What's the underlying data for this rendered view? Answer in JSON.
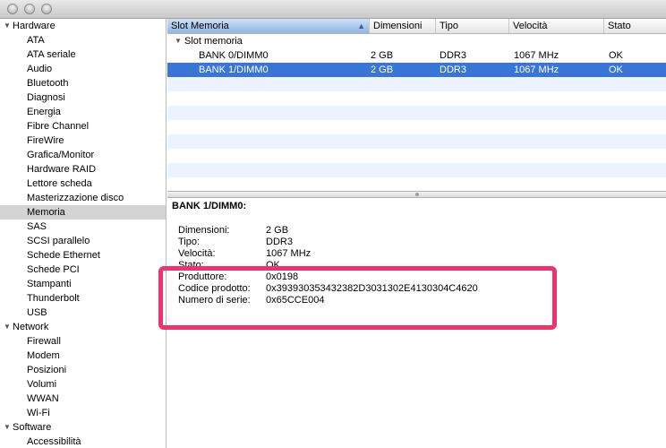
{
  "window": {
    "title": ""
  },
  "sidebar": {
    "rows": [
      {
        "kind": "cat",
        "label": "Hardware"
      },
      {
        "kind": "item",
        "label": "ATA"
      },
      {
        "kind": "item",
        "label": "ATA seriale"
      },
      {
        "kind": "item",
        "label": "Audio"
      },
      {
        "kind": "item",
        "label": "Bluetooth"
      },
      {
        "kind": "item",
        "label": "Diagnosi"
      },
      {
        "kind": "item",
        "label": "Energia"
      },
      {
        "kind": "item",
        "label": "Fibre Channel"
      },
      {
        "kind": "item",
        "label": "FireWire"
      },
      {
        "kind": "item",
        "label": "Grafica/Monitor"
      },
      {
        "kind": "item",
        "label": "Hardware RAID"
      },
      {
        "kind": "item",
        "label": "Lettore scheda"
      },
      {
        "kind": "item",
        "label": "Masterizzazione disco"
      },
      {
        "kind": "item",
        "label": "Memoria",
        "selected": true
      },
      {
        "kind": "item",
        "label": "SAS"
      },
      {
        "kind": "item",
        "label": "SCSI parallelo"
      },
      {
        "kind": "item",
        "label": "Schede Ethernet"
      },
      {
        "kind": "item",
        "label": "Schede PCI"
      },
      {
        "kind": "item",
        "label": "Stampanti"
      },
      {
        "kind": "item",
        "label": "Thunderbolt"
      },
      {
        "kind": "item",
        "label": "USB"
      },
      {
        "kind": "cat",
        "label": "Network"
      },
      {
        "kind": "item",
        "label": "Firewall"
      },
      {
        "kind": "item",
        "label": "Modem"
      },
      {
        "kind": "item",
        "label": "Posizioni"
      },
      {
        "kind": "item",
        "label": "Volumi"
      },
      {
        "kind": "item",
        "label": "WWAN"
      },
      {
        "kind": "item",
        "label": "Wi-Fi"
      },
      {
        "kind": "cat",
        "label": "Software"
      },
      {
        "kind": "item",
        "label": "Accessibilità"
      }
    ]
  },
  "table": {
    "columns": [
      "Slot Memoria",
      "Dimensioni",
      "Tipo",
      "Velocità",
      "Stato"
    ],
    "group": "Slot memoria",
    "rows": [
      {
        "cells": [
          "BANK 0/DIMM0",
          "2 GB",
          "DDR3",
          "1067 MHz",
          "OK"
        ],
        "selected": false
      },
      {
        "cells": [
          "BANK 1/DIMM0",
          "2 GB",
          "DDR3",
          "1067 MHz",
          "OK"
        ],
        "selected": true
      }
    ]
  },
  "details": {
    "title": "BANK 1/DIMM0:",
    "fields": [
      {
        "label": "Dimensioni:",
        "value": "2 GB"
      },
      {
        "label": "Tipo:",
        "value": "DDR3"
      },
      {
        "label": "Velocità:",
        "value": "1067 MHz"
      },
      {
        "label": "Stato:",
        "value": "OK"
      },
      {
        "label": "Produttore:",
        "value": "0x0198"
      },
      {
        "label": "Codice prodotto:",
        "value": "0x393930353432382D3031302E4130304C4620"
      },
      {
        "label": "Numero di serie:",
        "value": "0x65CCE004"
      }
    ]
  },
  "colors": {
    "selection": "#3875d7",
    "sidebar_selection": "#d4d4d4",
    "row_stripe": "#edf3fe",
    "highlight": "#f2336b"
  }
}
